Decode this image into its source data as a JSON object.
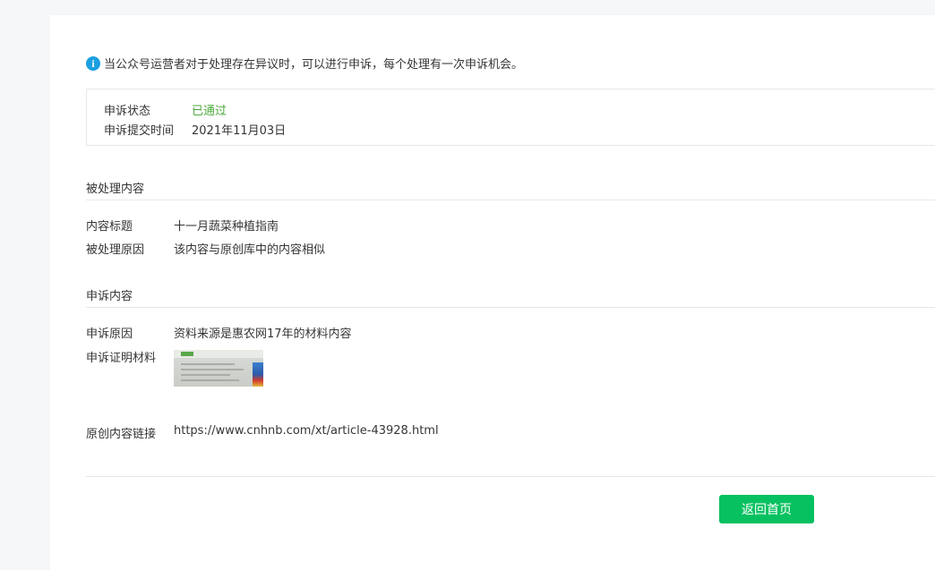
{
  "notice": {
    "icon": "info-icon",
    "text": "当公众号运营者对于处理存在异议时，可以进行申诉，每个处理有一次申诉机会。"
  },
  "status": {
    "state_label": "申诉状态",
    "state_value": "已通过",
    "state_color": "#4ca93c",
    "time_label": "申诉提交时间",
    "time_value": "2021年11月03日"
  },
  "processed": {
    "title": "被处理内容",
    "content_title_label": "内容标题",
    "content_title_value": "十一月蔬菜种植指南",
    "reason_label": "被处理原因",
    "reason_value": "该内容与原创库中的内容相似"
  },
  "appeal": {
    "title": "申诉内容",
    "reason_label": "申诉原因",
    "reason_value": "资料来源是惠农网17年的材料内容",
    "proof_label": "申诉证明材料",
    "link_label": "原创内容链接",
    "link_value": "https://www.cnhnb.com/xt/article-43928.html"
  },
  "actions": {
    "back_label": "返回首页",
    "back_color": "#07c160"
  }
}
